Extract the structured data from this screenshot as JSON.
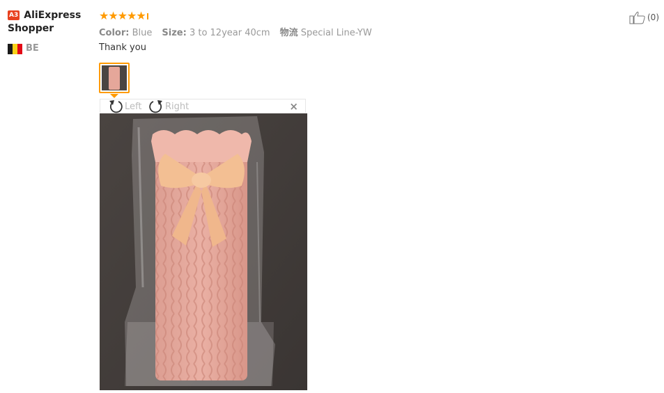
{
  "user": {
    "level_badge": "A3",
    "name_line1": "AliExpress",
    "name_line2": "Shopper",
    "country": "BE",
    "flag_colors": [
      "#1a1a1a",
      "#f7d117",
      "#e30a17"
    ]
  },
  "review": {
    "rating": 5,
    "stars": "★★★★★",
    "color_label": "Color:",
    "color_value": "Blue",
    "size_label": "Size:",
    "size_value": "3 to 12year 40cm",
    "shipping_label": "物流",
    "shipping_value": "Special Line-YW",
    "text": "Thank you"
  },
  "viewer": {
    "rotate_left": "Left",
    "rotate_right": "Right",
    "close": "×"
  },
  "helpful": {
    "count": "(0)"
  },
  "colors": {
    "star": "#ff9a00",
    "badge": "#e8411f",
    "muted_text": "#999999"
  }
}
